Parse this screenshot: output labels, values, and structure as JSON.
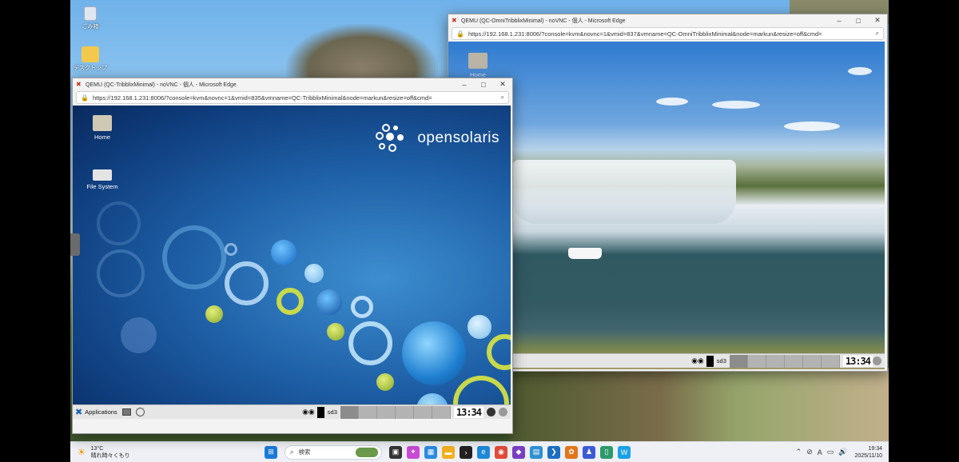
{
  "desktop": {
    "icons": [
      {
        "label": "ごみ箱"
      },
      {
        "label": "デスクトップ"
      }
    ]
  },
  "window_left": {
    "title": "QEMU (QC-TribblixMinimal) - noVNC - 個人 - Microsoft Edge",
    "url": "https://192.168.1.231:8006/?console=kvm&novnc=1&vmid=835&vmname=QC-TribblixMinimal&node=markun&resize=off&cmd=",
    "vm_icons": [
      {
        "label": "Home"
      },
      {
        "label": "File System"
      }
    ],
    "brand": "opensolaris",
    "panel": {
      "applications": "Applications",
      "workspace": "sd3",
      "clock": "13:34"
    }
  },
  "window_right": {
    "title": "QEMU (QC-OmniTribblixMinimal) - noVNC - 個人 - Microsoft Edge",
    "url": "https://192.168.1.231:8006/?console=kvm&novnc=1&vmid=837&vmname=QC-OmniTribblixMinimal&node=markun&resize=off&cmd=",
    "vm_icons": [
      {
        "label": "Home"
      }
    ],
    "panel": {
      "workspace": "sd3",
      "clock": "13:34"
    }
  },
  "taskbar": {
    "weather_temp": "13°C",
    "weather_desc": "晴れ時々くもり",
    "search_placeholder": "検索",
    "time": "19:34",
    "date": "2025/11/10",
    "ime": "A"
  }
}
